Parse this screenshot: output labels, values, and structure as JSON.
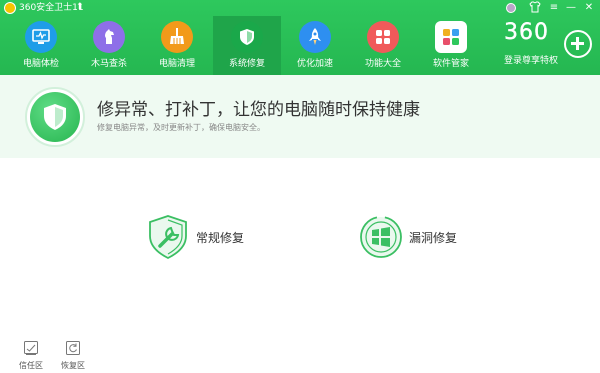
{
  "app": {
    "title": "360安全卫士11",
    "upgrade_icon": "up-arrow-icon"
  },
  "window_controls": [
    "medal-icon",
    "shirt-icon",
    "menu-icon",
    "minimize-icon",
    "close-icon"
  ],
  "nav": {
    "items": [
      {
        "label": "电脑体检",
        "icon": "monitor-check-icon",
        "color": "#1f9de8",
        "active": false
      },
      {
        "label": "木马查杀",
        "icon": "trojan-horse-icon",
        "color": "#8e6fe8",
        "active": false
      },
      {
        "label": "电脑清理",
        "icon": "broom-icon",
        "color": "#f29a1a",
        "active": false
      },
      {
        "label": "系统修复",
        "icon": "shield-icon",
        "color": "#1aa84a",
        "active": true
      },
      {
        "label": "优化加速",
        "icon": "rocket-icon",
        "color": "#2e8ff0",
        "active": false
      },
      {
        "label": "功能大全",
        "icon": "grid-icon",
        "color": "#f05a5a",
        "active": false
      },
      {
        "label": "软件管家",
        "icon": "app-store-icon",
        "color": "#ffffff",
        "active": false
      }
    ],
    "brand": {
      "logo": "360",
      "subtitle": "登录尊享特权"
    }
  },
  "banner": {
    "title": "修异常、打补丁，让您的电脑随时保持健康",
    "subtitle": "修复电脑异常，及时更新补丁，确保电脑安全。"
  },
  "actions": [
    {
      "label": "常规修复",
      "icon": "shield-wrench-icon"
    },
    {
      "label": "漏洞修复",
      "icon": "windows-logo-icon"
    }
  ],
  "tools": [
    {
      "label": "信任区",
      "icon": "trust-zone-icon"
    },
    {
      "label": "恢复区",
      "icon": "restore-icon"
    }
  ],
  "colors": {
    "header_green": "#2ec85d",
    "active_green": "#1fa54a",
    "accent": "#27b54f"
  }
}
